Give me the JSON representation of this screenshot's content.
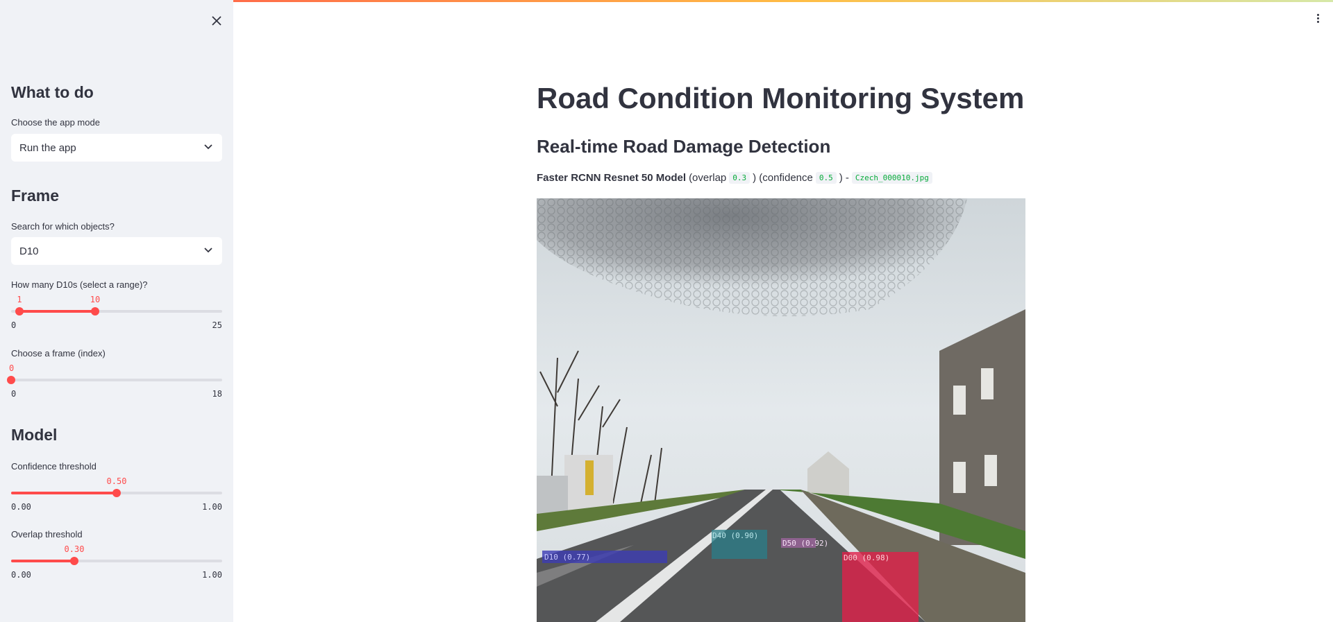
{
  "sidebar": {
    "close_icon": "close-icon",
    "sections": {
      "what_to_do": "What to do",
      "frame": "Frame",
      "model": "Model"
    },
    "app_mode": {
      "label": "Choose the app mode",
      "value": "Run the app"
    },
    "objects": {
      "label": "Search for which objects?",
      "value": "D10"
    },
    "count_range": {
      "label": "How many D10s (select a range)?",
      "low": "1",
      "high": "10",
      "min": "0",
      "max": "25",
      "low_value": 1,
      "high_value": 10
    },
    "frame_index": {
      "label": "Choose a frame (index)",
      "value": "0",
      "min": "0",
      "max": "18",
      "current": 0
    },
    "confidence": {
      "label": "Confidence threshold",
      "value": "0.50",
      "min": "0.00",
      "max": "1.00",
      "current": 0.5
    },
    "overlap": {
      "label": "Overlap threshold",
      "value": "0.30",
      "min": "0.00",
      "max": "1.00",
      "current": 0.3
    }
  },
  "header": {
    "menu_icon": "kebab-menu-icon"
  },
  "main": {
    "title": "Road Condition Monitoring System",
    "subtitle": "Real-time Road Damage Detection",
    "caption": {
      "model": "Faster RCNN Resnet 50 Model",
      "overlap_text": "(overlap",
      "overlap_value": "0.3",
      "confidence_text": ") (confidence",
      "confidence_value": "0.5",
      "separator": ") -",
      "filename": "Czech_000010.jpg"
    },
    "detections": [
      {
        "label": "D10 (0.77)",
        "color": "#3c3cb4"
      },
      {
        "label": "D40 (0.90)",
        "color": "#2a7f8a"
      },
      {
        "label": "D50 (0.92)",
        "color": "#b46ab4"
      },
      {
        "label": "D00 (0.98)",
        "color": "#e0204a"
      }
    ]
  },
  "colors": {
    "accent": "#ff4b4b",
    "sidebar_bg": "#f0f2f6",
    "code_green": "#09ab3b"
  }
}
